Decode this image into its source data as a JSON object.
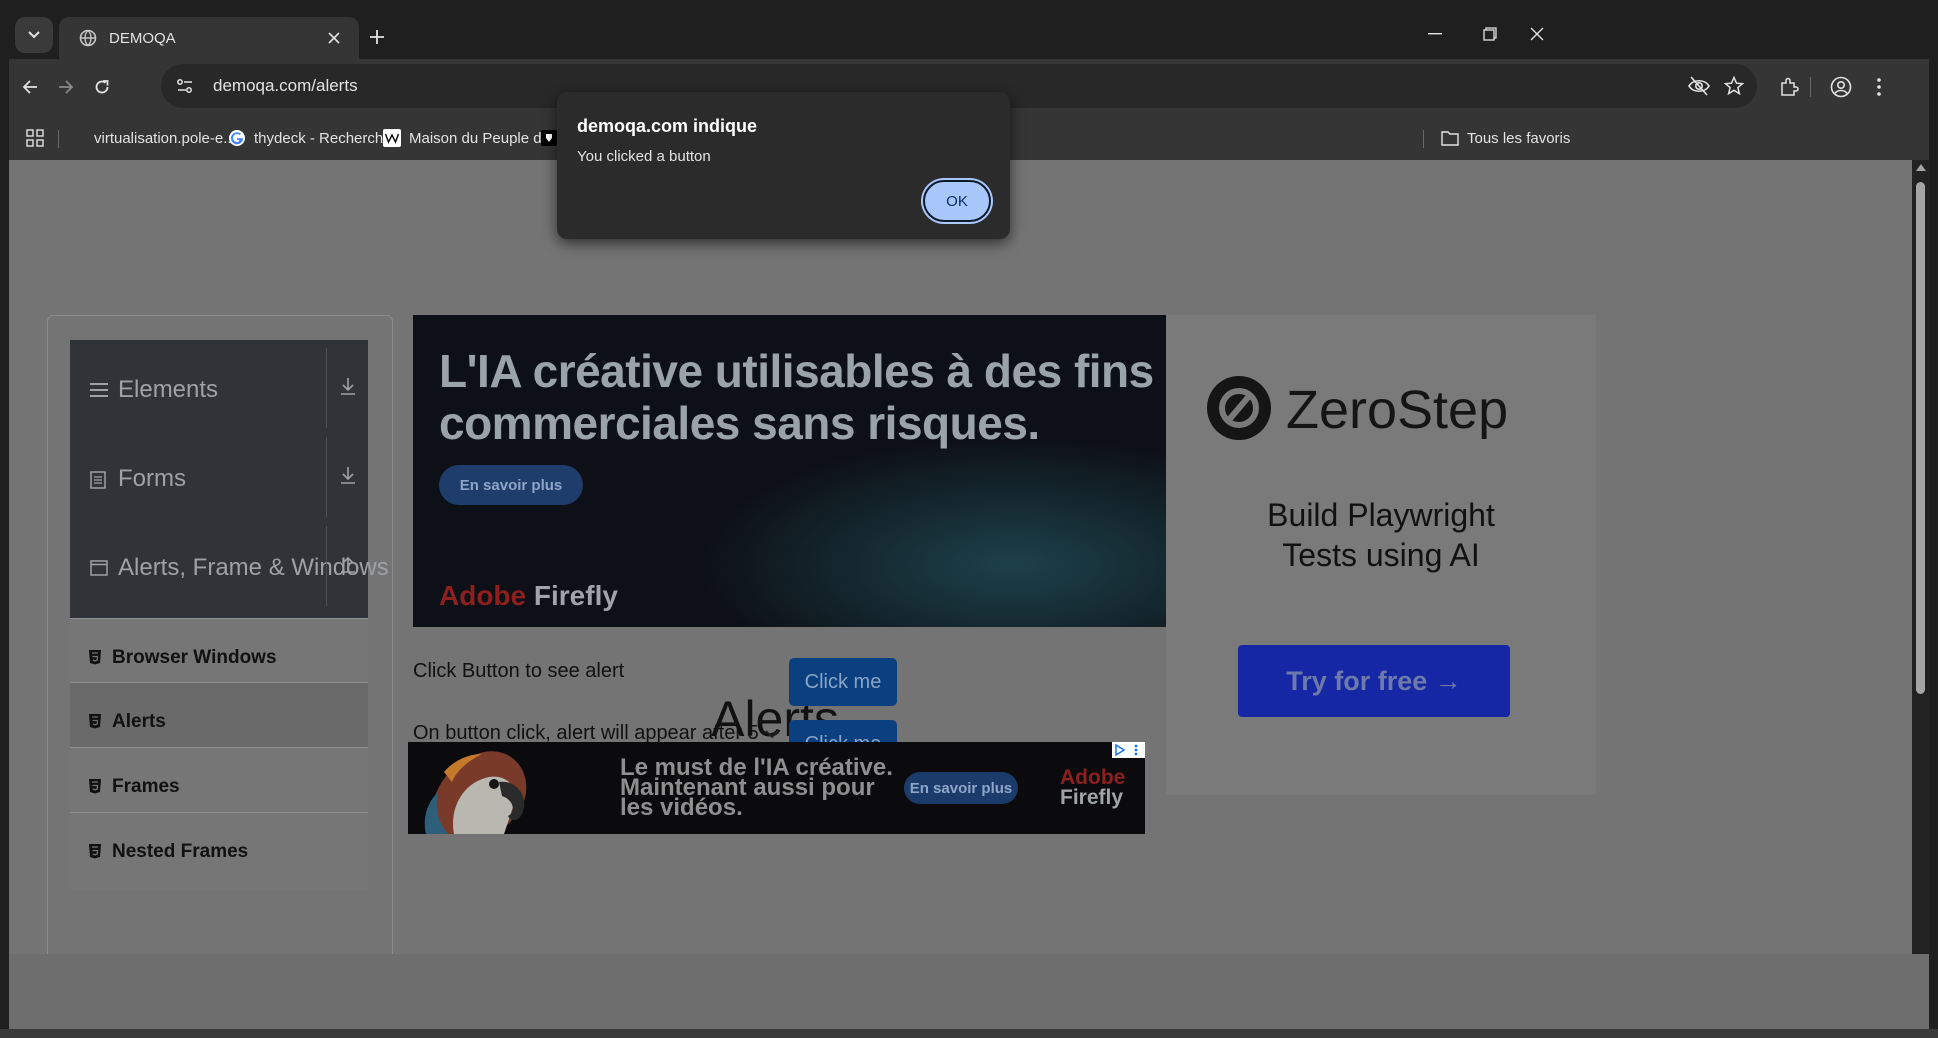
{
  "browser": {
    "tab": {
      "title": "DEMOQA"
    },
    "url": "demoqa.com/alerts",
    "bookmarks": [
      {
        "label": "virtualisation.pole-e..."
      },
      {
        "label": "thydeck - Recherch..."
      },
      {
        "label": "Maison du Peuple d..."
      }
    ],
    "all_bookmarks_label": "Tous les favoris"
  },
  "dialog": {
    "title": "demoqa.com indique",
    "message": "You clicked a button",
    "ok_label": "OK"
  },
  "sidebar": {
    "groups": [
      {
        "label": "Elements",
        "icon": "hamburger-icon",
        "arrow": "download-arrow-icon"
      },
      {
        "label": "Forms",
        "icon": "document-icon",
        "arrow": "download-arrow-icon"
      },
      {
        "label": "Alerts, Frame & Windows",
        "icon": "window-icon",
        "arrow": "upload-arrow-icon"
      }
    ],
    "items": [
      {
        "label": "Browser Windows"
      },
      {
        "label": "Alerts",
        "active": true
      },
      {
        "label": "Frames"
      },
      {
        "label": "Nested Frames"
      }
    ]
  },
  "ad_banner": {
    "headline": "L'IA créative utilisables à des fins commerciales sans risques.",
    "cta": "En savoir plus",
    "brand_adobe": "Adobe",
    "brand_firefly": "Firefly"
  },
  "side_ad": {
    "logo_name": "ZeroStep",
    "tagline_line1": "Build Playwright",
    "tagline_line2": "Tests using AI",
    "cta": "Try for free →"
  },
  "main": {
    "heading": "Alerts",
    "rows": [
      {
        "label": "Click Button to see alert",
        "button": "Click me"
      },
      {
        "label": "On button click, alert will appear after 5",
        "button": "Click me"
      }
    ]
  },
  "bottom_ad": {
    "line1": "Le must de l'IA créative.",
    "line2": "Maintenant aussi pour",
    "line3": "les vidéos.",
    "cta": "En savoir plus",
    "brand_adobe": "Adobe",
    "brand_firefly": "Firefly"
  },
  "colors": {
    "chrome_bg": "#1f1f1f",
    "toolbar_bg": "#353535",
    "dialog_bg": "#2b2b2b",
    "ok_button": "#a8c7fa",
    "click_button": "#0a4080",
    "overlay_page": "#747474"
  }
}
